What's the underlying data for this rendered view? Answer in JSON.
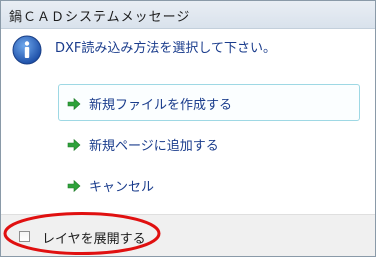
{
  "dialog": {
    "title": "鍋ＣＡＤシステムメッセージ",
    "icon": "info-icon",
    "message": "DXF読み込み方法を選択して下さい。"
  },
  "commands": [
    {
      "label": "新規ファイルを作成する",
      "icon": "green-arrow-icon",
      "active": true
    },
    {
      "label": "新規ページに追加する",
      "icon": "green-arrow-icon",
      "active": false
    },
    {
      "label": "キャンセル",
      "icon": "green-arrow-icon",
      "active": false
    }
  ],
  "footer": {
    "checkbox_label": "レイヤを展開する",
    "checkbox_checked": false
  },
  "colors": {
    "message_text": "#1a3c8c",
    "arrow_green": "#2ea23a",
    "highlight_ellipse": "#e01010",
    "active_border": "#9ed8e4"
  }
}
